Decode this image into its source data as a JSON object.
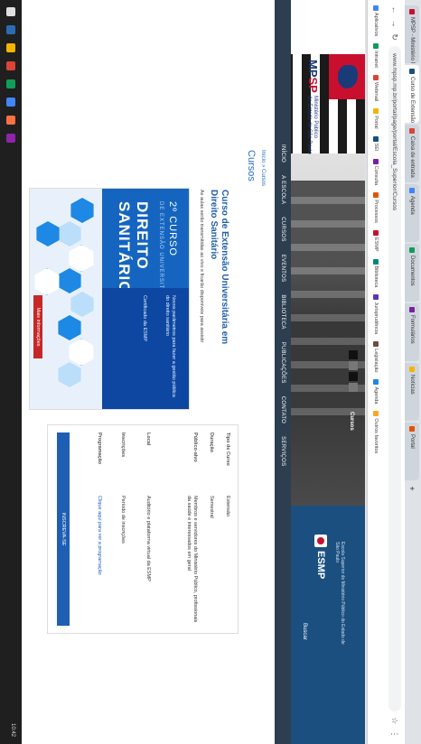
{
  "browser": {
    "tabs": [
      {
        "label": "MPSP - Ministério Público",
        "color": "#c8102e",
        "active": false
      },
      {
        "label": "Curso de Extensão",
        "color": "#1b4f80",
        "active": true
      },
      {
        "label": "Caixa de entrada",
        "color": "#db4437",
        "active": false
      },
      {
        "label": "Agenda",
        "color": "#4285f4",
        "active": false
      },
      {
        "label": "Documentos",
        "color": "#0f9d58",
        "active": false
      },
      {
        "label": "Formulários",
        "color": "#7b1fa2",
        "active": false
      },
      {
        "label": "Notícias",
        "color": "#f4b400",
        "active": false
      },
      {
        "label": "Portal",
        "color": "#e65100",
        "active": false
      }
    ],
    "url": "www.mpsp.mp.br/portal/page/portal/Escola_Superior/Cursos",
    "bookmarks": [
      "Aplicativos",
      "Intranet",
      "Webmail",
      "Portal",
      "SEI",
      "Consulta",
      "Processos",
      "ESMP",
      "Biblioteca",
      "Jurisprudência",
      "Legislação",
      "Agenda",
      "Outros favoritos"
    ]
  },
  "site": {
    "logo_mp": "MP",
    "logo_sp": "SP",
    "logo_sub_line1": "Ministério Público",
    "logo_sub_line2": "do Estado de São Paulo",
    "esmp": "ESMP",
    "esmp_caption": "Escola Superior do Ministério Público do Estado de São Paulo",
    "nav_label": "Cursos",
    "search": "Buscar",
    "menu": [
      "INÍCIO",
      "A ESCOLA",
      "CURSOS",
      "EVENTOS",
      "BIBLIOTECA",
      "PUBLICAÇÕES",
      "CONTATO",
      "SERVIÇOS"
    ]
  },
  "content": {
    "breadcrumb": "Início » Cursos",
    "section_title": "Cursos",
    "course_title": "Curso de Extensão Universitária em Direito Sanitário",
    "course_note": "As aulas serão transmitidas ao vivo e ficarão disponíveis para assistir"
  },
  "poster": {
    "line1": "2º CURSO",
    "line2": "DE EXTENSÃO UNIVERSITÁRIA EM",
    "line3": "DIREITO",
    "line4": "SANITÁRIO",
    "bullets": [
      "Novos parâmetros para fazer a gestão pública do direito sanitário",
      "Certificado da ESMP"
    ],
    "button": "Mais informações"
  },
  "info": {
    "rows": [
      {
        "label": "Tipo de Curso",
        "value": "Extensão"
      },
      {
        "label": "Duração",
        "value": "Semestral"
      },
      {
        "label": "Público-alvo",
        "value": "Membros e servidores do Ministério Público, profissionais da saúde e interessados em geral"
      },
      {
        "label": "Local",
        "value": "Auditório e plataforma virtual da ESMP"
      },
      {
        "label": "Inscrições",
        "value": "Período de inscrições"
      },
      {
        "label": "Programação",
        "value": "Clique aqui para ver a programação"
      }
    ],
    "button": "INSCREVA-SE"
  },
  "taskbar": {
    "icons": [
      "#e0e0e0",
      "#2b6cb0",
      "#f4b400",
      "#db4437",
      "#0f9d58",
      "#4285f4",
      "#ff7043",
      "#8e24aa"
    ],
    "time": "10:42"
  }
}
